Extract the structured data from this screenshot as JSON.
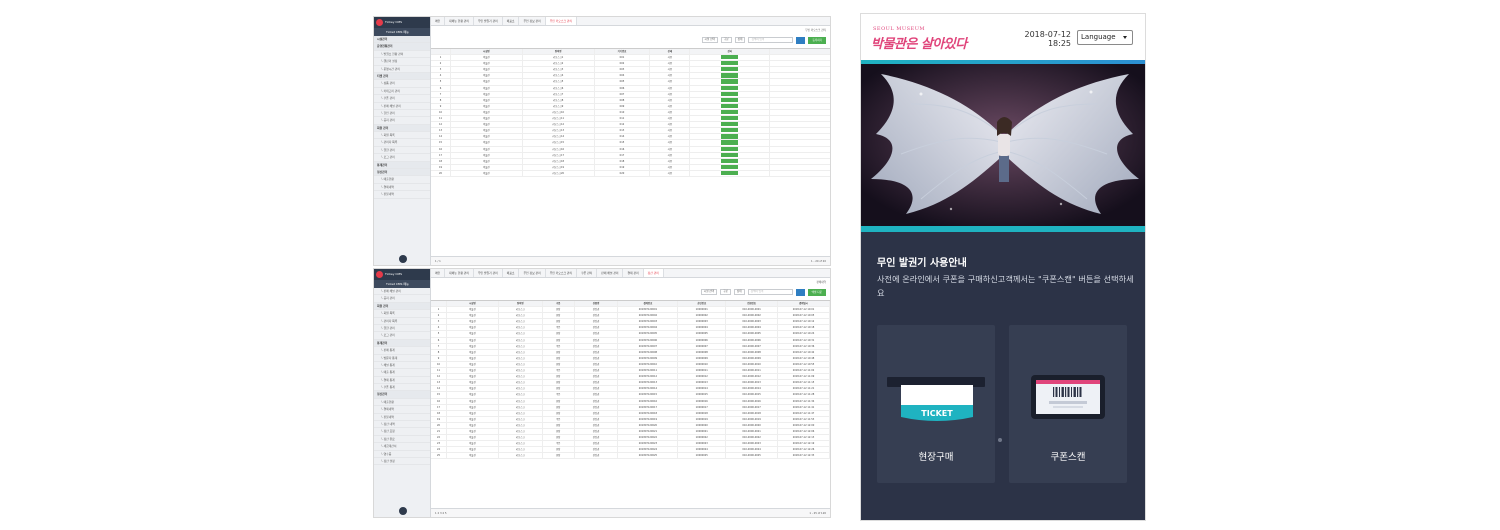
{
  "admin_top": {
    "brand": "Tickey CMS",
    "user": "Ticket CMS 메뉴",
    "menu": [
      {
        "label": "시설관리",
        "group": true
      },
      {
        "label": "운영현황관리",
        "group": true
      },
      {
        "label": "└ 발권소 현황 관리",
        "group": false
      },
      {
        "label": "└ 캘린더 설정",
        "group": false
      },
      {
        "label": "└ 운영시간 관리",
        "group": false
      },
      {
        "label": "티켓 관리",
        "group": true
      },
      {
        "label": "└ 상품 관리",
        "group": false
      },
      {
        "label": "└ 카테고리 관리",
        "group": false
      },
      {
        "label": "└ 쿠폰 관리",
        "group": false
      },
      {
        "label": "└ 판매 채널 관리",
        "group": false
      },
      {
        "label": "└ 할인 관리",
        "group": false
      },
      {
        "label": "└ 공지 관리",
        "group": false
      },
      {
        "label": "회원 관리",
        "group": true
      },
      {
        "label": "└ 회원 목록",
        "group": false
      },
      {
        "label": "└ 관리자 목록",
        "group": false
      },
      {
        "label": "└ 권한 관리",
        "group": false
      },
      {
        "label": "└ 로그 관리",
        "group": false
      },
      {
        "label": "통계관리",
        "group": true
      },
      {
        "label": "정산관리",
        "group": true
      },
      {
        "label": "└ 매출현황",
        "group": false
      },
      {
        "label": "└ 결제내역",
        "group": false
      },
      {
        "label": "└ 환불내역",
        "group": false
      }
    ],
    "tabs": [
      "메인",
      "대메뉴 현황 관리",
      "무인 발권기 관리",
      "매표소",
      "무인 정보 관리",
      "무인 키오스크 관리"
    ],
    "breadcrumb": "무인 키오스크 관리",
    "filter": {
      "select1": "시설 선택",
      "select2": "구분",
      "select3": "상태",
      "search_placeholder": "검색어 입력",
      "register": "등록하기"
    },
    "columns": [
      "",
      "시설명",
      "장비명",
      "기기번호",
      "상태",
      "관리"
    ],
    "rows": [
      [
        "1",
        "박물관",
        "키오스크1",
        "K01",
        "사용",
        ""
      ],
      [
        "2",
        "박물관",
        "키오스크2",
        "K02",
        "사용",
        ""
      ],
      [
        "3",
        "박물관",
        "키오스크3",
        "K03",
        "사용",
        ""
      ],
      [
        "4",
        "박물관",
        "키오스크4",
        "K04",
        "사용",
        ""
      ],
      [
        "5",
        "박물관",
        "키오스크5",
        "K05",
        "사용",
        ""
      ],
      [
        "6",
        "박물관",
        "키오스크6",
        "K06",
        "사용",
        ""
      ],
      [
        "7",
        "박물관",
        "키오스크7",
        "K07",
        "사용",
        ""
      ],
      [
        "8",
        "박물관",
        "키오스크8",
        "K08",
        "사용",
        ""
      ],
      [
        "9",
        "박물관",
        "키오스크9",
        "K09",
        "사용",
        ""
      ],
      [
        "10",
        "박물관",
        "키오스크10",
        "K10",
        "사용",
        ""
      ],
      [
        "11",
        "박물관",
        "키오스크11",
        "K11",
        "사용",
        ""
      ],
      [
        "12",
        "박물관",
        "키오스크12",
        "K12",
        "사용",
        ""
      ],
      [
        "13",
        "박물관",
        "키오스크13",
        "K13",
        "사용",
        ""
      ],
      [
        "14",
        "박물관",
        "키오스크14",
        "K14",
        "사용",
        ""
      ],
      [
        "15",
        "박물관",
        "키오스크15",
        "K15",
        "사용",
        ""
      ],
      [
        "16",
        "박물관",
        "키오스크16",
        "K16",
        "사용",
        ""
      ],
      [
        "17",
        "박물관",
        "키오스크17",
        "K17",
        "사용",
        ""
      ],
      [
        "18",
        "박물관",
        "키오스크18",
        "K18",
        "사용",
        ""
      ],
      [
        "19",
        "박물관",
        "키오스크19",
        "K19",
        "사용",
        ""
      ],
      [
        "20",
        "박물관",
        "키오스크20",
        "K20",
        "사용",
        ""
      ]
    ],
    "pager": "1 / 1",
    "pager_info": "1 - 20 of 20"
  },
  "admin_bottom": {
    "brand": "Tickey CMS",
    "user": "Ticket CMS 메뉴",
    "menu": [
      {
        "label": "└ 판매 채널 관리",
        "group": false
      },
      {
        "label": "└ 공지 관리",
        "group": false
      },
      {
        "label": "회원 관리",
        "group": true
      },
      {
        "label": "└ 회원 목록",
        "group": false
      },
      {
        "label": "└ 관리자 목록",
        "group": false
      },
      {
        "label": "└ 권한 관리",
        "group": false
      },
      {
        "label": "└ 로그 관리",
        "group": false
      },
      {
        "label": "통계관리",
        "group": true
      },
      {
        "label": "└ 판매 통계",
        "group": false
      },
      {
        "label": "└ 방문자 통계",
        "group": false
      },
      {
        "label": "└ 채널 통계",
        "group": false
      },
      {
        "label": "└ 매출 통계",
        "group": false
      },
      {
        "label": "└ 결제 통계",
        "group": false
      },
      {
        "label": "└ 쿠폰 통계",
        "group": false
      },
      {
        "label": "정산관리",
        "group": true
      },
      {
        "label": "└ 매출현황",
        "group": false
      },
      {
        "label": "└ 결제내역",
        "group": false
      },
      {
        "label": "└ 환불내역",
        "group": false
      },
      {
        "label": "└ 정산 내역",
        "group": false
      },
      {
        "label": "└ 정산 요청",
        "group": false
      },
      {
        "label": "└ 정산 완료",
        "group": false
      },
      {
        "label": "└ 세금계산서",
        "group": false
      },
      {
        "label": "└ 영수증",
        "group": false
      },
      {
        "label": "└ 정산 설정",
        "group": false
      }
    ],
    "tabs": [
      "메인",
      "대메뉴 현황 관리",
      "무인 발권기 관리",
      "매표소",
      "무인 정보 관리",
      "무인 키오스크 관리",
      "쿠폰 관리",
      "판매 채널 관리",
      "결제 관리",
      "정산 관리"
    ],
    "breadcrumb": "판매내역",
    "filter": {
      "select1": "시설 선택",
      "select2": "구분",
      "select3": "상태",
      "search_placeholder": "검색어 입력",
      "register": "엑셀 다운"
    },
    "columns": [
      "",
      "시설명",
      "장비명",
      "구분",
      "상품명",
      "결제번호",
      "승인번호",
      "전화번호",
      "결제일시"
    ],
    "rows": [
      [
        "1",
        "박물관",
        "키오스크",
        "현장",
        "관람권",
        "201807120001",
        "10000001",
        "010-0000-0001",
        "2018-07-12 10:01"
      ],
      [
        "2",
        "박물관",
        "키오스크",
        "현장",
        "관람권",
        "201807120002",
        "10000002",
        "010-0000-0002",
        "2018-07-12 10:05"
      ],
      [
        "3",
        "박물관",
        "키오스크",
        "현장",
        "관람권",
        "201807120003",
        "10000003",
        "010-0000-0003",
        "2018-07-12 10:12"
      ],
      [
        "4",
        "박물관",
        "키오스크",
        "쿠폰",
        "관람권",
        "201807120004",
        "10000004",
        "010-0000-0004",
        "2018-07-12 10:18"
      ],
      [
        "5",
        "박물관",
        "키오스크",
        "현장",
        "관람권",
        "201807120005",
        "10000005",
        "010-0000-0005",
        "2018-07-12 10:24"
      ],
      [
        "6",
        "박물관",
        "키오스크",
        "현장",
        "관람권",
        "201807120006",
        "10000006",
        "010-0000-0006",
        "2018-07-12 10:31"
      ],
      [
        "7",
        "박물관",
        "키오스크",
        "쿠폰",
        "관람권",
        "201807120007",
        "10000007",
        "010-0000-0007",
        "2018-07-12 10:36"
      ],
      [
        "8",
        "박물관",
        "키오스크",
        "현장",
        "관람권",
        "201807120008",
        "10000008",
        "010-0000-0008",
        "2018-07-12 10:42"
      ],
      [
        "9",
        "박물관",
        "키오스크",
        "현장",
        "관람권",
        "201807120009",
        "10000009",
        "010-0000-0009",
        "2018-07-12 10:48"
      ],
      [
        "10",
        "박물관",
        "키오스크",
        "현장",
        "관람권",
        "201807120010",
        "10000010",
        "010-0000-0010",
        "2018-07-12 10:55"
      ],
      [
        "11",
        "박물관",
        "키오스크",
        "쿠폰",
        "관람권",
        "201807120011",
        "10000011",
        "010-0000-0011",
        "2018-07-12 11:02"
      ],
      [
        "12",
        "박물관",
        "키오스크",
        "현장",
        "관람권",
        "201807120012",
        "10000012",
        "010-0000-0012",
        "2018-07-12 11:09"
      ],
      [
        "13",
        "박물관",
        "키오스크",
        "현장",
        "관람권",
        "201807120013",
        "10000013",
        "010-0000-0013",
        "2018-07-12 11:15"
      ],
      [
        "14",
        "박물관",
        "키오스크",
        "현장",
        "관람권",
        "201807120014",
        "10000014",
        "010-0000-0014",
        "2018-07-12 11:21"
      ],
      [
        "15",
        "박물관",
        "키오스크",
        "쿠폰",
        "관람권",
        "201807120015",
        "10000015",
        "010-0000-0015",
        "2018-07-12 11:28"
      ],
      [
        "16",
        "박물관",
        "키오스크",
        "현장",
        "관람권",
        "201807120016",
        "10000016",
        "010-0000-0016",
        "2018-07-12 11:34"
      ],
      [
        "17",
        "박물관",
        "키오스크",
        "현장",
        "관람권",
        "201807120017",
        "10000017",
        "010-0000-0017",
        "2018-07-12 11:41"
      ],
      [
        "18",
        "박물관",
        "키오스크",
        "현장",
        "관람권",
        "201807120018",
        "10000018",
        "010-0000-0018",
        "2018-07-12 11:47"
      ],
      [
        "19",
        "박물관",
        "키오스크",
        "쿠폰",
        "관람권",
        "201807120019",
        "10000019",
        "010-0000-0019",
        "2018-07-12 11:53"
      ],
      [
        "20",
        "박물관",
        "키오스크",
        "현장",
        "관람권",
        "201807120020",
        "10000020",
        "010-0000-0020",
        "2018-07-12 12:00"
      ],
      [
        "21",
        "박물관",
        "키오스크",
        "현장",
        "관람권",
        "201807120021",
        "10000021",
        "010-0000-0021",
        "2018-07-12 12:06"
      ],
      [
        "22",
        "박물관",
        "키오스크",
        "현장",
        "관람권",
        "201807120022",
        "10000022",
        "010-0000-0022",
        "2018-07-12 12:13"
      ],
      [
        "23",
        "박물관",
        "키오스크",
        "쿠폰",
        "관람권",
        "201807120023",
        "10000023",
        "010-0000-0023",
        "2018-07-12 12:19"
      ],
      [
        "24",
        "박물관",
        "키오스크",
        "현장",
        "관람권",
        "201807120024",
        "10000024",
        "010-0000-0024",
        "2018-07-12 12:26"
      ],
      [
        "25",
        "박물관",
        "키오스크",
        "현장",
        "관람권",
        "201807120025",
        "10000025",
        "010-0000-0025",
        "2018-07-12 12:33"
      ]
    ],
    "pager": "1 2 3 4 5",
    "pager_info": "1 - 25 of 120"
  },
  "kiosk": {
    "logo_small": "SEOUL MUSEUM",
    "logo": "박물관은 살아있다",
    "date": "2018-07-12",
    "time": "18:25",
    "language": "Language",
    "title": "무인 발권기 사용안내",
    "description": "사전에 온라인에서 쿠폰을 구매하신고객께서는 \"쿠폰스캔\" 버튼을 선택하세요",
    "ticket_word": "TICKET",
    "buttons": [
      "현장구매",
      "쿠폰스캔"
    ],
    "colors": {
      "brand_pink": "#e0457b",
      "accent_teal": "#1fb3c1",
      "panel_bg": "#2c3347"
    }
  }
}
